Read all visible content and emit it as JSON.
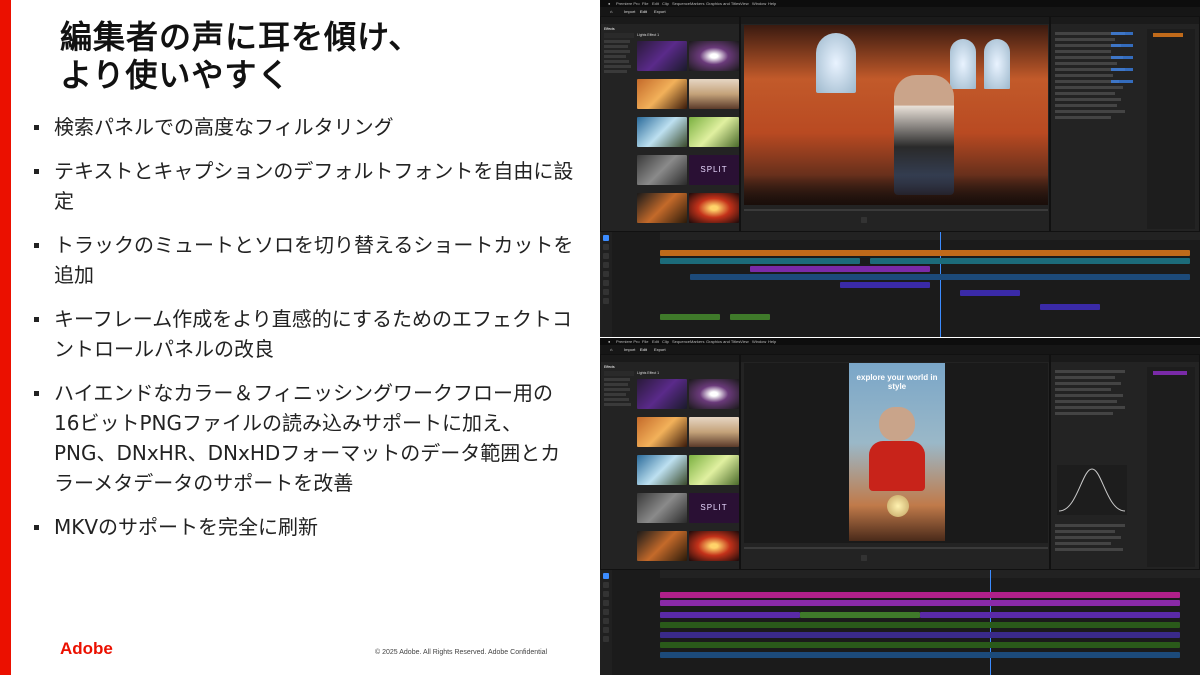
{
  "slide": {
    "title_line1": "編集者の声に耳を傾け、",
    "title_line2": "より使いやすく",
    "bullets": [
      "検索パネルでの高度なフィルタリング",
      "テキストとキャプションのデフォルトフォントを自由に設定",
      "トラックのミュートとソロを切り替えるショートカットを追加",
      "キーフレーム作成をより直感的にするためのエフェクトコントロールパネルの改良",
      "ハイエンドなカラー＆フィニッシングワークフロー用の16ビットPNGファイルの読み込みサポートに加え、PNG、DNxHR、DNxHDフォーマットのデータ範囲とカラーメタデータのサポートを改善",
      "MKVのサポートを完全に刷新"
    ],
    "logo": "Adobe",
    "copyright": "© 2025 Adobe. All Rights Reserved. Adobe Confidential"
  },
  "screenshots": {
    "app_name": "Premiere Pro",
    "menu_items": [
      "File",
      "Edit",
      "Clip",
      "Sequence",
      "Markers",
      "Graphics and Titles",
      "View",
      "Window",
      "Help"
    ],
    "workspace_tabs": [
      "Import",
      "Edit",
      "Export"
    ],
    "effects_panel_title": "Effects",
    "effects_list_header": "Lights Effect 1",
    "effect_thumbnail_title": "SPLIT",
    "vertical_video_text": "explore your world in style"
  },
  "colors": {
    "accent": "#eb1000",
    "app_background": "#1e1e1e",
    "playhead": "#3c8cff",
    "clip_purple": "#7a2aa8",
    "clip_teal": "#1c6b7a",
    "clip_green": "#3f7a2a",
    "clip_orange": "#c06a1a"
  }
}
